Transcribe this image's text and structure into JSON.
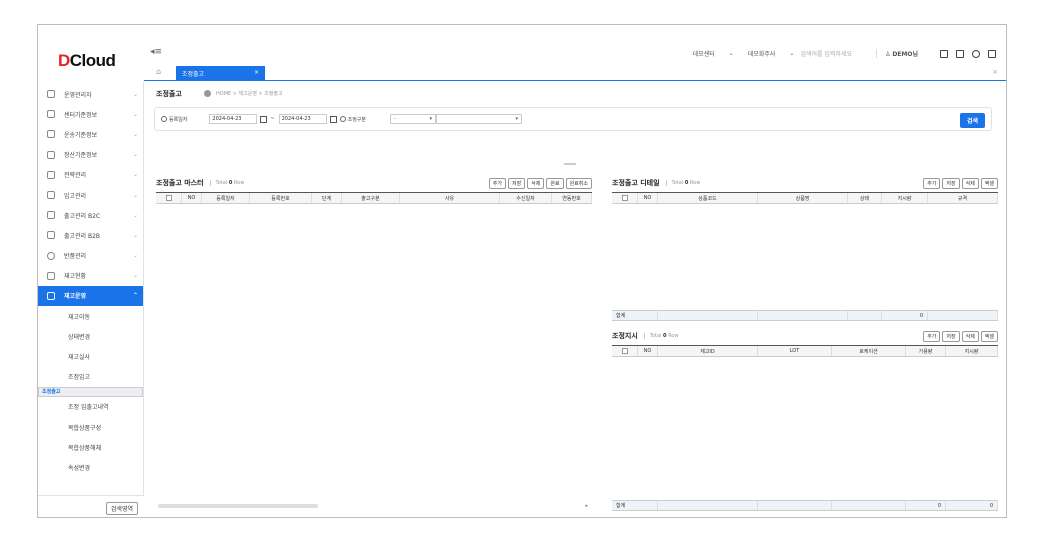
{
  "app": {
    "logo_d": "D",
    "logo_text": "Cloud",
    "tab_label": "조정출고",
    "tab_close": "×",
    "menu_icon": "≡",
    "home_icon": "⌂",
    "close_all": "×"
  },
  "topbar": {
    "center": "데모센터",
    "company": "데모화주사",
    "search_placeholder": "검색어를 입력하세요",
    "user": "DEMO님",
    "chev": "⌄"
  },
  "sidebar": {
    "items": [
      {
        "label": "운영관리자"
      },
      {
        "label": "센터기준정보"
      },
      {
        "label": "운송기준정보"
      },
      {
        "label": "정산기준정보"
      },
      {
        "label": "전략관리"
      },
      {
        "label": "입고관리"
      },
      {
        "label": "출고관리 B2C"
      },
      {
        "label": "출고관리 B2B"
      },
      {
        "label": "반품관리"
      },
      {
        "label": "재고현황"
      },
      {
        "label": "재고운영"
      }
    ],
    "subitems": [
      "재고이동",
      "상태변경",
      "재고실사",
      "조정입고",
      "조정출고",
      "조정 입출고내역",
      "복합상품구성",
      "복합상품해체",
      "속성변경"
    ],
    "search_area": "검색영역"
  },
  "page": {
    "title": "조정출고",
    "breadcrumb": "HOME > 재고운영 > 조정출고"
  },
  "filter": {
    "reg_date_label": "등록일자",
    "date_from": "2024-04-23",
    "tilde": "~",
    "date_to": "2024-04-23",
    "adj_type_label": "조정구분",
    "select_value": "-",
    "search_btn": "검색"
  },
  "master": {
    "title": "조정출고 마스터",
    "total_label": "Total",
    "total_count": "0",
    "row": "Row",
    "buttons": [
      "추가",
      "저장",
      "삭제",
      "완료",
      "완료취소"
    ],
    "columns": [
      "NO",
      "등록일자",
      "등록번호",
      "단계",
      "출고구분",
      "사유",
      "수신일자",
      "연동번호"
    ]
  },
  "detail": {
    "title": "조정출고 디테일",
    "total_label": "Total",
    "total_count": "0",
    "row": "Row",
    "buttons": [
      "추가",
      "저장",
      "삭제",
      "엑셀"
    ],
    "columns": [
      "NO",
      "상품코드",
      "상품명",
      "상태",
      "지시량",
      "규격"
    ],
    "sum_label": "합계",
    "sum_qty": "0"
  },
  "order": {
    "title": "조정지시",
    "total_label": "Total",
    "total_count": "0",
    "row": "Row",
    "buttons": [
      "추가",
      "저장",
      "삭제",
      "엑셀"
    ],
    "columns": [
      "NO",
      "재고ID",
      "LOT",
      "로케이션",
      "가용량",
      "지시량"
    ],
    "sum_label": "합계",
    "sum_avail": "0",
    "sum_qty": "0"
  }
}
